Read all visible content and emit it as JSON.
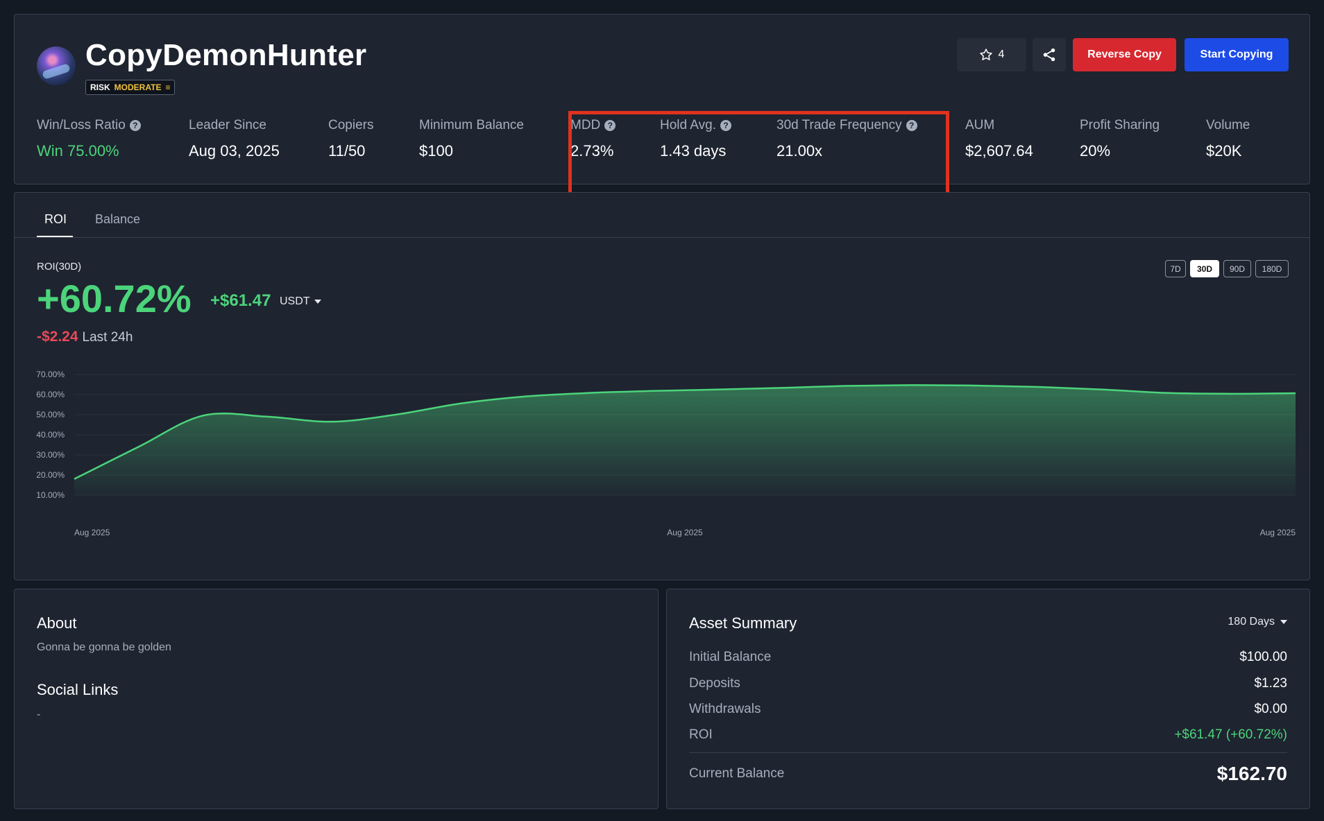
{
  "trader": {
    "name": "CopyDemonHunter",
    "risk_label": "RISK",
    "risk_value": "MODERATE",
    "risk_icon": "≡"
  },
  "actions": {
    "star_count": "4",
    "reverse_copy": "Reverse Copy",
    "start_copying": "Start Copying"
  },
  "stats": [
    {
      "label": "Win/Loss Ratio",
      "value": "Win 75.00%",
      "help": true
    },
    {
      "label": "Leader Since",
      "value": "Aug 03, 2025"
    },
    {
      "label": "Copiers",
      "value": "11/50"
    },
    {
      "label": "Minimum Balance",
      "value": "$100"
    },
    {
      "label": "MDD",
      "value": "2.73%",
      "help": true
    },
    {
      "label": "Hold Avg.",
      "value": "1.43 days",
      "help": true
    },
    {
      "label": "30d Trade Frequency",
      "value": "21.00x",
      "help": true
    },
    {
      "label": "AUM",
      "value": "$2,607.64"
    },
    {
      "label": "Profit Sharing",
      "value": "20%"
    },
    {
      "label": "Volume",
      "value": "$20K"
    }
  ],
  "tabs": [
    "ROI",
    "Balance"
  ],
  "roi": {
    "label": "ROI(30D)",
    "percent": "+60.72%",
    "amount": "+$61.47",
    "currency": "USDT",
    "change_24h": "-$2.24",
    "change_24h_label": "Last 24h"
  },
  "periods": [
    "7D",
    "30D",
    "90D",
    "180D"
  ],
  "chart_data": {
    "type": "area",
    "title": "",
    "xlabel": "",
    "ylabel": "",
    "ylim": [
      10,
      70
    ],
    "y_ticks": [
      "70.00%",
      "60.00%",
      "50.00%",
      "40.00%",
      "30.00%",
      "20.00%",
      "10.00%"
    ],
    "x_ticks": [
      "Aug 2025",
      "Aug 2025",
      "Aug 2025"
    ],
    "series": [
      {
        "values": [
          18,
          34,
          49.5,
          49,
          46.5,
          50,
          55.5,
          59,
          60.8,
          61.8,
          62.5,
          63.3,
          64.3,
          64.7,
          64.5,
          63.8,
          62.5,
          60.8,
          60.4,
          60.7
        ]
      }
    ],
    "color": "#4cd47b"
  },
  "about": {
    "title": "About",
    "text": "Gonna be gonna be golden",
    "social_title": "Social Links",
    "social_value": "-"
  },
  "assets": {
    "title": "Asset Summary",
    "period": "180 Days",
    "rows": [
      {
        "label": "Initial Balance",
        "value": "$100.00"
      },
      {
        "label": "Deposits",
        "value": "$1.23"
      },
      {
        "label": "Withdrawals",
        "value": "$0.00"
      },
      {
        "label": "ROI",
        "value": "+$61.47 (+60.72%)"
      }
    ],
    "current_label": "Current Balance",
    "current_value": "$162.70"
  }
}
